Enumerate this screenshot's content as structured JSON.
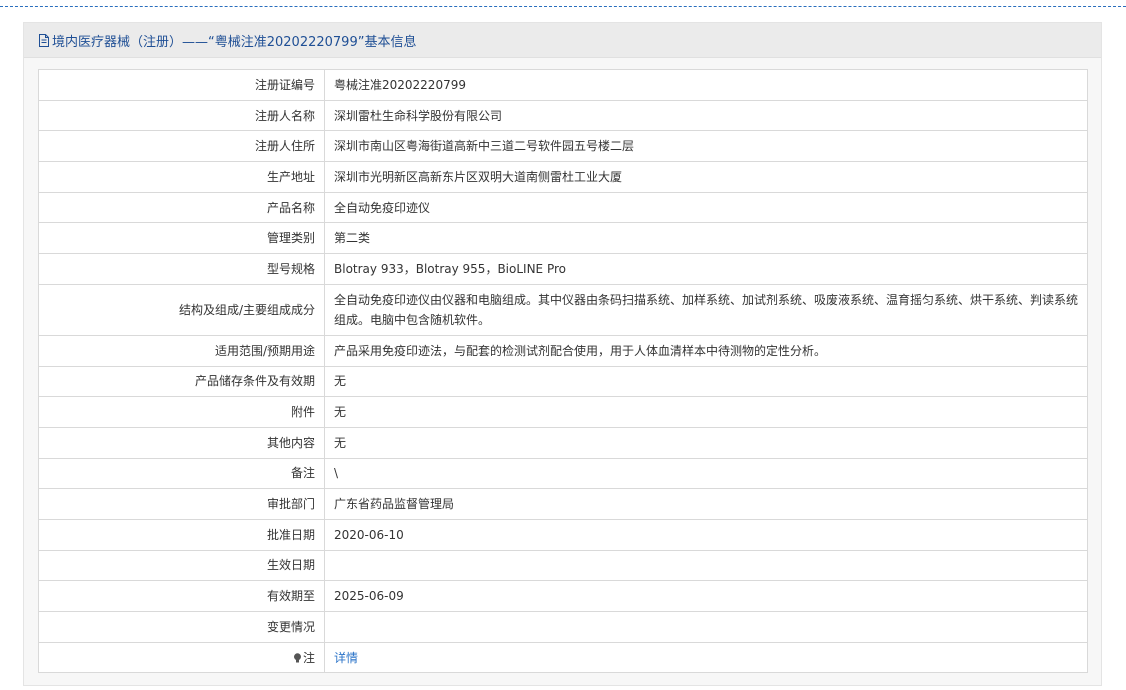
{
  "header": {
    "title": "境内医疗器械（注册）——“粤械注准20202220799”基本信息"
  },
  "rows": [
    {
      "label": "注册证编号",
      "value": "粤械注准20202220799"
    },
    {
      "label": "注册人名称",
      "value": "深圳雷杜生命科学股份有限公司"
    },
    {
      "label": "注册人住所",
      "value": "深圳市南山区粤海街道高新中三道二号软件园五号楼二层"
    },
    {
      "label": "生产地址",
      "value": "深圳市光明新区高新东片区双明大道南侧雷杜工业大厦"
    },
    {
      "label": "产品名称",
      "value": "全自动免疫印迹仪"
    },
    {
      "label": "管理类别",
      "value": "第二类"
    },
    {
      "label": "型号规格",
      "value": "Blotray 933，Blotray 955，BioLINE Pro"
    },
    {
      "label": "结构及组成/主要组成成分",
      "value": "全自动免疫印迹仪由仪器和电脑组成。其中仪器由条码扫描系统、加样系统、加试剂系统、吸废液系统、温育摇匀系统、烘干系统、判读系统组成。电脑中包含随机软件。"
    },
    {
      "label": "适用范围/预期用途",
      "value": "产品采用免疫印迹法，与配套的检测试剂配合使用，用于人体血清样本中待测物的定性分析。"
    },
    {
      "label": "产品储存条件及有效期",
      "value": "无"
    },
    {
      "label": "附件",
      "value": "无"
    },
    {
      "label": "其他内容",
      "value": "无"
    },
    {
      "label": "备注",
      "value": "\\"
    },
    {
      "label": "审批部门",
      "value": "广东省药品监督管理局"
    },
    {
      "label": "批准日期",
      "value": "2020-06-10"
    },
    {
      "label": "生效日期",
      "value": ""
    },
    {
      "label": "有效期至",
      "value": "2025-06-09"
    },
    {
      "label": "变更情况",
      "value": ""
    },
    {
      "label": "注",
      "value": "详情"
    }
  ],
  "colors": {
    "title": "#1f4f95",
    "link": "#2a73c8",
    "border": "#d9d9d9",
    "header_bg": "#ebebeb"
  }
}
